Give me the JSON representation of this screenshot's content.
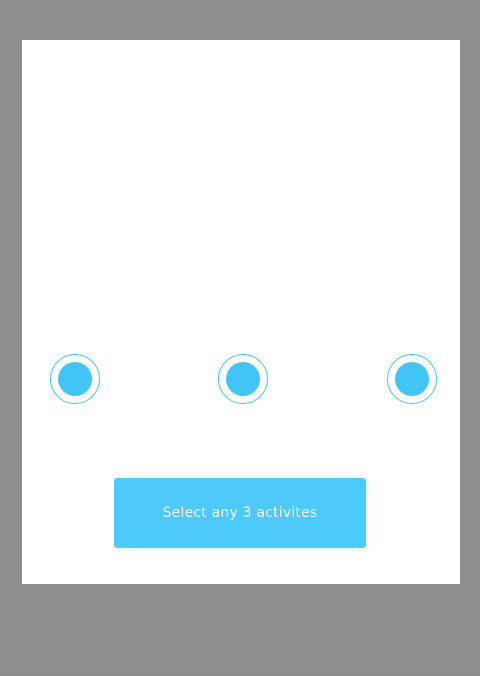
{
  "selection": {
    "options": [
      {
        "selected": true
      },
      {
        "selected": true
      },
      {
        "selected": true
      }
    ],
    "cta_label": "Select any 3 activites"
  },
  "colors": {
    "background": "#8e8e8e",
    "panel": "#ffffff",
    "accent": "#41c4f8",
    "button": "#4ccafb",
    "button_text": "#ffffff"
  }
}
